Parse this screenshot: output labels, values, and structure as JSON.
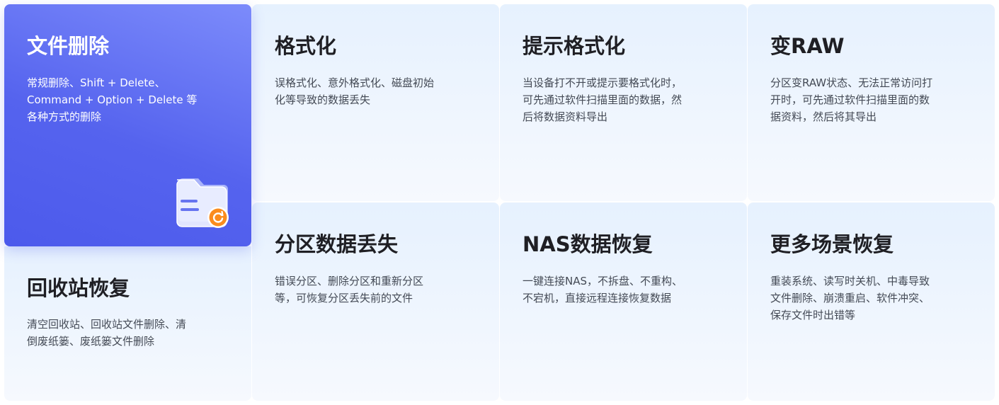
{
  "cards": [
    {
      "title": "文件删除",
      "desc": "常规删除、Shift + Delete、Command + Option + Delete 等各种方式的删除",
      "icon": "folder-recover-icon"
    },
    {
      "title": "回收站恢复",
      "desc": "清空回收站、回收站文件删除、清倒废纸篓、废纸篓文件删除"
    },
    {
      "title": "格式化",
      "desc": "误格式化、意外格式化、磁盘初始化等导致的数据丢失"
    },
    {
      "title": "提示格式化",
      "desc": "当设备打不开或提示要格式化时，可先通过软件扫描里面的数据，然后将数据资料导出"
    },
    {
      "title": "变RAW",
      "desc": "分区变RAW状态、无法正常访问打开时，可先通过软件扫描里面的数据资料，然后将其导出"
    },
    {
      "title": "分区数据丢失",
      "desc": "错误分区、删除分区和重新分区等，可恢复分区丢失前的文件"
    },
    {
      "title": "NAS数据恢复",
      "desc": "一键连接NAS，不拆盘、不重构、不宕机，直接远程连接恢复数据"
    },
    {
      "title": "更多场景恢复",
      "desc": "重装系统、读写时关机、中毒导致文件删除、崩溃重启、软件冲突、保存文件时出错等"
    }
  ],
  "colors": {
    "active_start": "#7c8bfb",
    "active_end": "#4c5aec",
    "card_bg_top": "#e6f1fe",
    "card_bg_bottom": "#f6f9fe",
    "title_text": "#1f1f24",
    "desc_text": "#444a55",
    "badge_orange": "#fb8c1e"
  }
}
